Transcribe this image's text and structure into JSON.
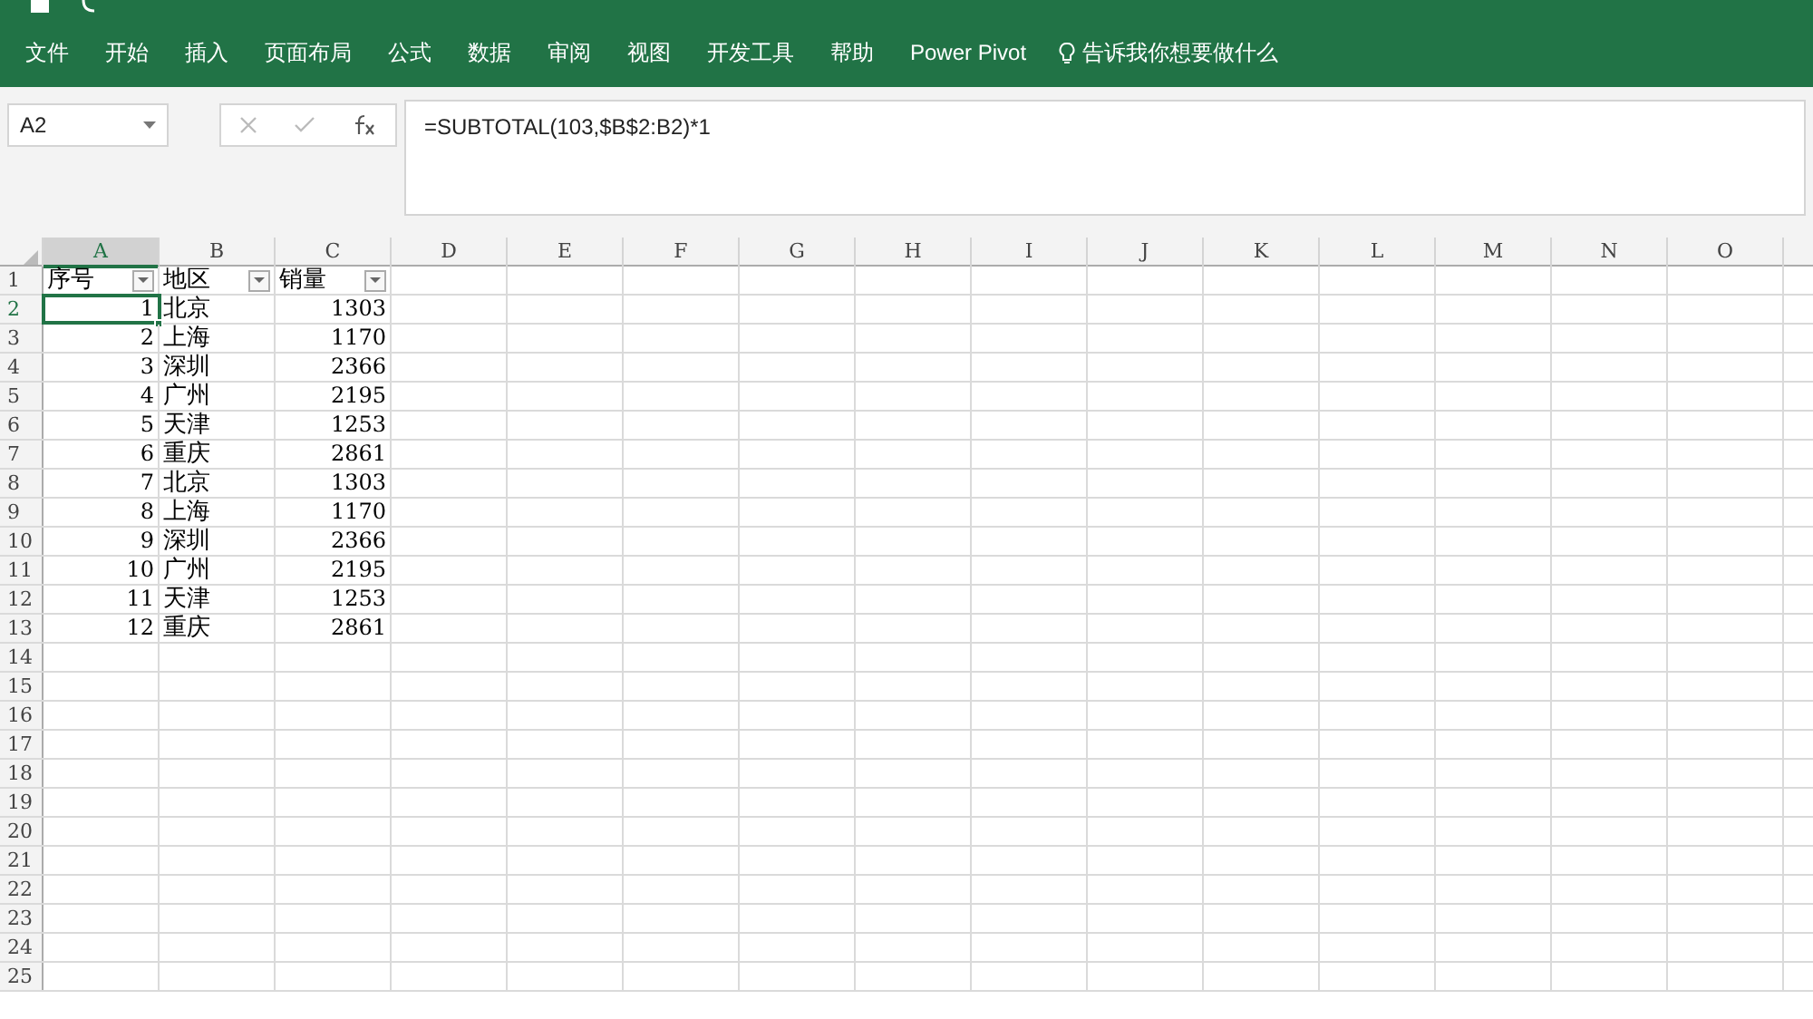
{
  "ribbon_tabs": [
    {
      "label": "文件"
    },
    {
      "label": "开始"
    },
    {
      "label": "插入"
    },
    {
      "label": "页面布局"
    },
    {
      "label": "公式"
    },
    {
      "label": "数据"
    },
    {
      "label": "审阅"
    },
    {
      "label": "视图"
    },
    {
      "label": "开发工具"
    },
    {
      "label": "帮助"
    },
    {
      "label": "Power Pivot"
    },
    {
      "label": "告诉我你想要做什么",
      "kind": "search"
    }
  ],
  "name_box": "A2",
  "formula": "=SUBTOTAL(103,$B$2:B2)*1",
  "columns": [
    {
      "label": "A",
      "selected": true
    },
    {
      "label": "B",
      "selected": false
    },
    {
      "label": "C",
      "selected": false
    },
    {
      "label": "D",
      "selected": false
    },
    {
      "label": "E",
      "selected": false
    },
    {
      "label": "F",
      "selected": false
    },
    {
      "label": "G",
      "selected": false
    },
    {
      "label": "H",
      "selected": false
    },
    {
      "label": "I",
      "selected": false
    },
    {
      "label": "J",
      "selected": false
    },
    {
      "label": "K",
      "selected": false
    },
    {
      "label": "L",
      "selected": false
    },
    {
      "label": "M",
      "selected": false
    },
    {
      "label": "N",
      "selected": false
    },
    {
      "label": "O",
      "selected": false
    }
  ],
  "rows": [
    {
      "number": "1",
      "selected": false,
      "kind": "header",
      "cells": [
        "序号",
        "地区",
        "销量"
      ]
    },
    {
      "number": "2",
      "selected": true,
      "cells": [
        "1",
        "北京",
        "1303"
      ]
    },
    {
      "number": "3",
      "selected": false,
      "cells": [
        "2",
        "上海",
        "1170"
      ]
    },
    {
      "number": "4",
      "selected": false,
      "cells": [
        "3",
        "深圳",
        "2366"
      ]
    },
    {
      "number": "5",
      "selected": false,
      "cells": [
        "4",
        "广州",
        "2195"
      ]
    },
    {
      "number": "6",
      "selected": false,
      "cells": [
        "5",
        "天津",
        "1253"
      ]
    },
    {
      "number": "7",
      "selected": false,
      "cells": [
        "6",
        "重庆",
        "2861"
      ]
    },
    {
      "number": "8",
      "selected": false,
      "cells": [
        "7",
        "北京",
        "1303"
      ]
    },
    {
      "number": "9",
      "selected": false,
      "cells": [
        "8",
        "上海",
        "1170"
      ]
    },
    {
      "number": "10",
      "selected": false,
      "cells": [
        "9",
        "深圳",
        "2366"
      ]
    },
    {
      "number": "11",
      "selected": false,
      "cells": [
        "10",
        "广州",
        "2195"
      ]
    },
    {
      "number": "12",
      "selected": false,
      "cells": [
        "11",
        "天津",
        "1253"
      ]
    },
    {
      "number": "13",
      "selected": false,
      "cells": [
        "12",
        "重庆",
        "2861"
      ]
    },
    {
      "number": "14",
      "selected": false
    },
    {
      "number": "15",
      "selected": false
    },
    {
      "number": "16",
      "selected": false
    },
    {
      "number": "17",
      "selected": false
    },
    {
      "number": "18",
      "selected": false
    },
    {
      "number": "19",
      "selected": false
    },
    {
      "number": "20",
      "selected": false
    },
    {
      "number": "21",
      "selected": false
    },
    {
      "number": "22",
      "selected": false
    },
    {
      "number": "23",
      "selected": false
    },
    {
      "number": "24",
      "selected": false
    },
    {
      "number": "25",
      "selected": false
    }
  ]
}
